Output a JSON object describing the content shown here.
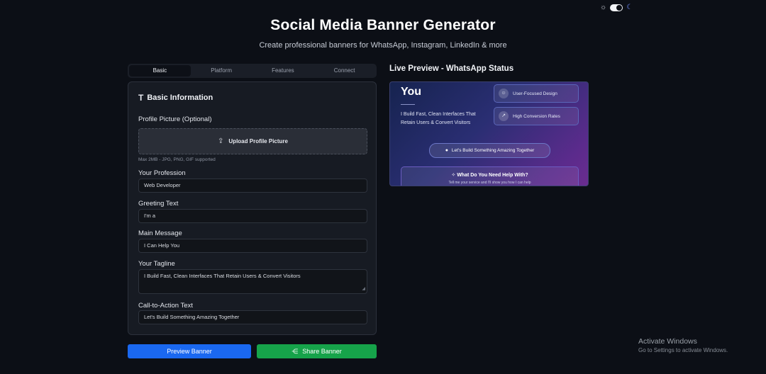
{
  "theme": {
    "light_icon": "sun-icon",
    "dark_icon": "moon-icon",
    "mode": "dark"
  },
  "header": {
    "title": "Social Media Banner Generator",
    "subtitle": "Create professional banners for WhatsApp, Instagram, LinkedIn & more"
  },
  "tabs": [
    "Basic",
    "Platform",
    "Features",
    "Connect"
  ],
  "active_tab": "Basic",
  "form": {
    "section_title": "Basic Information",
    "section_icon": "text-type-icon",
    "profile_picture": {
      "label": "Profile Picture (Optional)",
      "upload_label": "Upload Profile Picture",
      "hint": "Max 2MB - JPG, PNG, GIF supported"
    },
    "profession": {
      "label": "Your Profession",
      "value": "Web Developer"
    },
    "greeting": {
      "label": "Greeting Text",
      "value": "I'm a"
    },
    "main_message": {
      "label": "Main Message",
      "value": "I Can Help You"
    },
    "tagline": {
      "label": "Your Tagline",
      "value": "I Build Fast, Clean Interfaces That Retain Users & Convert Visitors"
    },
    "cta": {
      "label": "Call-to-Action Text",
      "value": "Let's Build Something Amazing Together"
    }
  },
  "buttons": {
    "preview": "Preview Banner",
    "share": "Share Banner"
  },
  "preview": {
    "title": "Live Preview - WhatsApp Status",
    "headline": "You",
    "tagline": "I Build Fast, Clean Interfaces That Retain Users & Convert Visitors",
    "badges": [
      {
        "label": "User-Focused Design",
        "icon": "users-icon"
      },
      {
        "label": "High Conversion Rates",
        "icon": "trending-up-icon"
      }
    ],
    "cta": "Let's Build Something Amazing Together",
    "help_title": "What Do You Need Help With?",
    "help_subtitle": "Tell me your service and I'll show you how I can help"
  },
  "windows_watermark": {
    "line1": "Activate Windows",
    "line2": "Go to Settings to activate Windows."
  },
  "colors": {
    "background": "#0c0f16",
    "preview_button": "#1a68f0",
    "share_button": "#16a34a"
  }
}
